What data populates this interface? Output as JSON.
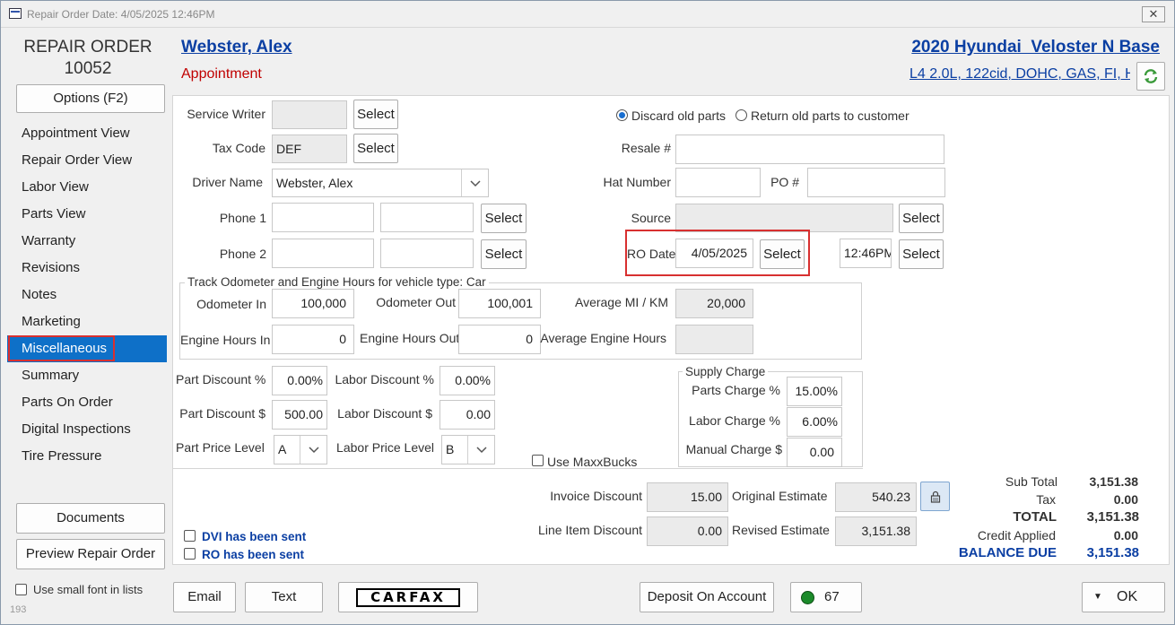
{
  "window": {
    "title": "Repair Order Date: 4/05/2025  12:46PM",
    "close_glyph": "✕"
  },
  "sidebar": {
    "heading_line1": "REPAIR ORDER",
    "heading_line2": "10052",
    "options_button": "Options (F2)",
    "items": [
      {
        "label": "Appointment View"
      },
      {
        "label": "Repair Order View"
      },
      {
        "label": "Labor View"
      },
      {
        "label": "Parts View"
      },
      {
        "label": "Warranty"
      },
      {
        "label": "Revisions"
      },
      {
        "label": "Notes"
      },
      {
        "label": "Marketing"
      },
      {
        "label": "Miscellaneous"
      },
      {
        "label": "Summary"
      },
      {
        "label": "Parts On Order"
      },
      {
        "label": "Digital Inspections"
      },
      {
        "label": "Tire Pressure"
      }
    ],
    "active_item": "Miscellaneous",
    "documents_button": "Documents",
    "preview_button": "Preview Repair Order",
    "small_font_label": "Use small font in lists",
    "corner_number": "193"
  },
  "header": {
    "customer_name": "Webster, Alex",
    "status": "Appointment",
    "vehicle": "2020 Hyundai  Veloster N Base",
    "engine": "L4 2.0L, 122cid, DOHC, GAS, FI, H"
  },
  "form": {
    "service_writer_label": "Service Writer",
    "service_writer_value": "",
    "tax_code_label": "Tax Code",
    "tax_code_value": "DEF",
    "driver_name_label": "Driver Name",
    "driver_name_value": "Webster, Alex",
    "phone1_label": "Phone 1",
    "phone2_label": "Phone 2",
    "select_label": "Select",
    "discard_parts_label": "Discard old parts",
    "return_parts_label": "Return old parts to customer",
    "resale_label": "Resale #",
    "hat_number_label": "Hat Number",
    "po_label": "PO #",
    "source_label": "Source",
    "ro_date_label": "RO Date",
    "ro_date_value": "4/05/2025",
    "ro_time_value": "12:46PM"
  },
  "odometer": {
    "group_title": "Track Odometer and Engine Hours for vehicle type: Car",
    "odometer_in_label": "Odometer In",
    "odometer_in_value": "100,000",
    "odometer_out_label": "Odometer Out",
    "odometer_out_value": "100,001",
    "avg_mi_label": "Average MI / KM",
    "avg_mi_value": "20,000",
    "engine_hours_in_label": "Engine Hours In",
    "engine_hours_in_value": "0",
    "engine_hours_out_label": "Engine Hours Out",
    "engine_hours_out_value": "0",
    "avg_engine_hours_label": "Average Engine Hours",
    "avg_engine_hours_value": ""
  },
  "discounts": {
    "part_discount_pct_label": "Part Discount %",
    "part_discount_pct_value": "0.00%",
    "labor_discount_pct_label": "Labor Discount %",
    "labor_discount_pct_value": "0.00%",
    "part_discount_amt_label": "Part Discount $",
    "part_discount_amt_value": "500.00",
    "labor_discount_amt_label": "Labor Discount $",
    "labor_discount_amt_value": "0.00",
    "part_price_level_label": "Part Price Level",
    "part_price_level_value": "A",
    "labor_price_level_label": "Labor Price Level",
    "labor_price_level_value": "B",
    "maxxbucks_label": "Use MaxxBucks"
  },
  "supply_charge": {
    "group_title": "Supply Charge",
    "parts_charge_label": "Parts Charge %",
    "parts_charge_value": "15.00%",
    "labor_charge_label": "Labor Charge %",
    "labor_charge_value": "6.00%",
    "manual_charge_label": "Manual Charge $",
    "manual_charge_value": "0.00"
  },
  "summary": {
    "invoice_discount_label": "Invoice Discount",
    "invoice_discount_value": "15.00",
    "line_item_discount_label": "Line Item Discount",
    "line_item_discount_value": "0.00",
    "original_estimate_label": "Original Estimate",
    "original_estimate_value": "540.23",
    "revised_estimate_label": "Revised Estimate",
    "revised_estimate_value": "3,151.38",
    "dvi_sent_label": "DVI has been sent",
    "ro_sent_label": "RO has been sent",
    "sub_total_label": "Sub Total",
    "sub_total_value": "3,151.38",
    "tax_label": "Tax",
    "tax_value": "0.00",
    "total_label": "TOTAL",
    "total_value": "3,151.38",
    "credit_applied_label": "Credit Applied",
    "credit_applied_value": "0.00",
    "balance_due_label": "BALANCE DUE",
    "balance_due_value": "3,151.38"
  },
  "footer": {
    "email_button": "Email",
    "text_button": "Text",
    "carfax_label": "CARFAX",
    "deposit_button": "Deposit On Account",
    "status_count": "67",
    "ok_button": "OK"
  },
  "colors": {
    "accent": "#0e70c8",
    "link": "#0b3fa3",
    "status_red": "#c00000",
    "highlight": "#d83030",
    "status_green": "#1b8a2a"
  }
}
